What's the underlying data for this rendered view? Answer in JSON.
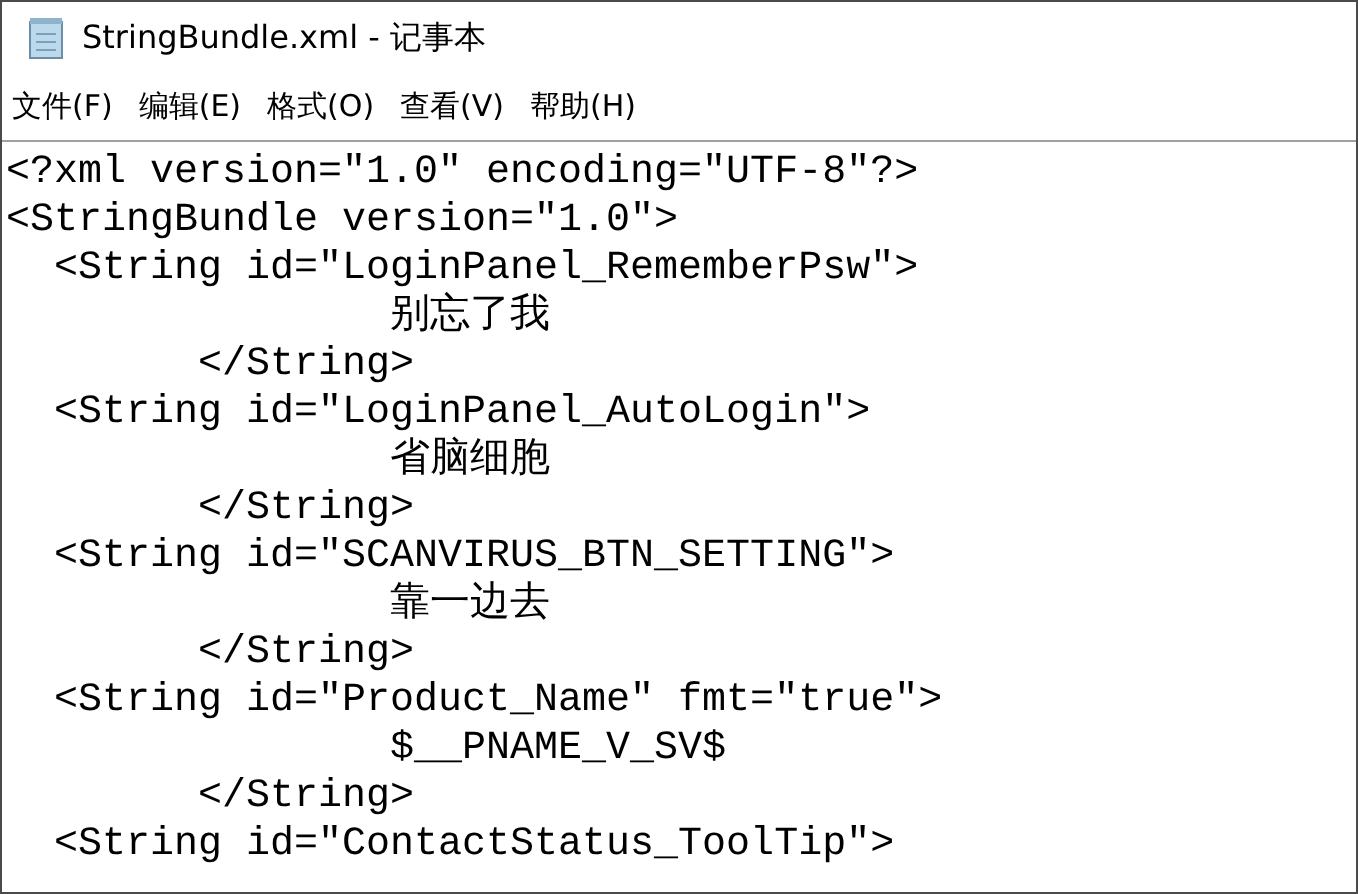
{
  "window": {
    "title": "StringBundle.xml - 记事本"
  },
  "menu": [
    "文件(F)",
    "编辑(E)",
    "格式(O)",
    "查看(V)",
    "帮助(H)"
  ],
  "editor": {
    "lines": [
      "<?xml version=\"1.0\" encoding=\"UTF-8\"?>",
      "<StringBundle version=\"1.0\">",
      "  <String id=\"LoginPanel_RememberPsw\">",
      "                别忘了我",
      "        </String>",
      "  <String id=\"LoginPanel_AutoLogin\">",
      "                省脑细胞",
      "        </String>",
      "  <String id=\"SCANVIRUS_BTN_SETTING\">",
      "                靠一边去",
      "        </String>",
      "  <String id=\"Product_Name\" fmt=\"true\">",
      "                $__PNAME_V_SV$",
      "        </String>",
      "  <String id=\"ContactStatus_ToolTip\">"
    ]
  }
}
